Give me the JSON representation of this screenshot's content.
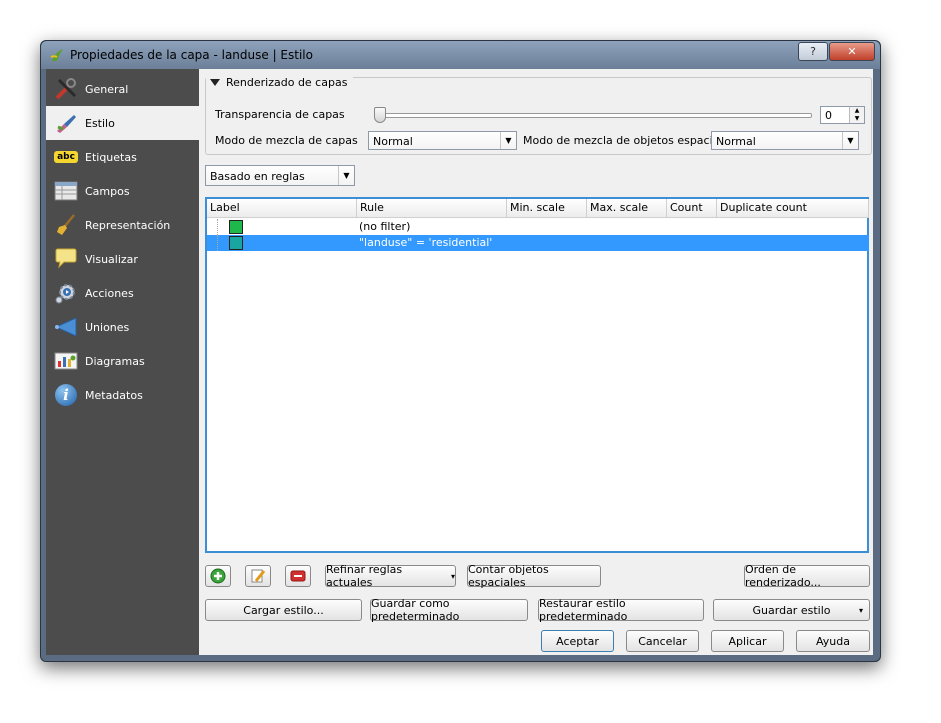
{
  "window": {
    "title": "Propiedades de la capa - landuse | Estilo",
    "help_label": "?",
    "close_label": "✕"
  },
  "sidebar": {
    "items": [
      {
        "label": "General",
        "icon": "tools-icon",
        "active": false
      },
      {
        "label": "Estilo",
        "icon": "brush-icon",
        "active": true
      },
      {
        "label": "Etiquetas",
        "icon": "abc-label-icon",
        "active": false
      },
      {
        "label": "Campos",
        "icon": "table-icon",
        "active": false
      },
      {
        "label": "Representación",
        "icon": "broom-icon",
        "active": false
      },
      {
        "label": "Visualizar",
        "icon": "speech-bubble-icon",
        "active": false
      },
      {
        "label": "Acciones",
        "icon": "gear-icon",
        "active": false
      },
      {
        "label": "Uniones",
        "icon": "join-icon",
        "active": false
      },
      {
        "label": "Diagramas",
        "icon": "diagram-icon",
        "active": false
      },
      {
        "label": "Metadatos",
        "icon": "info-icon",
        "active": false
      }
    ],
    "abc_glyph": "abc",
    "info_glyph": "i"
  },
  "render_group": {
    "title": "Renderizado de capas",
    "transparency_label": "Transparencia de capas",
    "transparency_value": "0",
    "transparency_level": 0,
    "blend_label": "Modo de mezcla de capas",
    "blend_value": "Normal",
    "feature_blend_label": "Modo de mezcla de objetos espaciales",
    "feature_blend_value": "Normal"
  },
  "renderer": {
    "value": "Basado en reglas"
  },
  "rules_table": {
    "columns": [
      "Label",
      "Rule",
      "Min. scale",
      "Max. scale",
      "Count",
      "Duplicate count"
    ],
    "rows": [
      {
        "label": "",
        "rule": "(no filter)",
        "min_scale": "",
        "max_scale": "",
        "count": "",
        "dup": "",
        "color": "#1fb84a",
        "selected": false
      },
      {
        "label": "",
        "rule": "\"landuse\"  =  'residential'",
        "min_scale": "",
        "max_scale": "",
        "count": "",
        "dup": "",
        "color": "#1aa6a0",
        "selected": true
      }
    ]
  },
  "toolbar": {
    "add_rule_icon": "add-rule-icon",
    "edit_rule_icon": "edit-rule-icon",
    "remove_rule_icon": "remove-rule-icon",
    "refine_label": "Refinar reglas actuales",
    "count_label": "Contar objetos espaciales",
    "order_label": "Orden de renderizado..."
  },
  "style_buttons": {
    "load": "Cargar estilo...",
    "save_default": "Guardar como predeterminado",
    "restore_default": "Restaurar estilo predeterminado",
    "save": "Guardar estilo"
  },
  "dialog_buttons": {
    "accept": "Aceptar",
    "cancel": "Cancelar",
    "apply": "Aplicar",
    "help": "Ayuda"
  },
  "glyphs": {
    "dropdown": "▼",
    "caret": "▾",
    "spin_up": "▲",
    "spin_down": "▼"
  }
}
